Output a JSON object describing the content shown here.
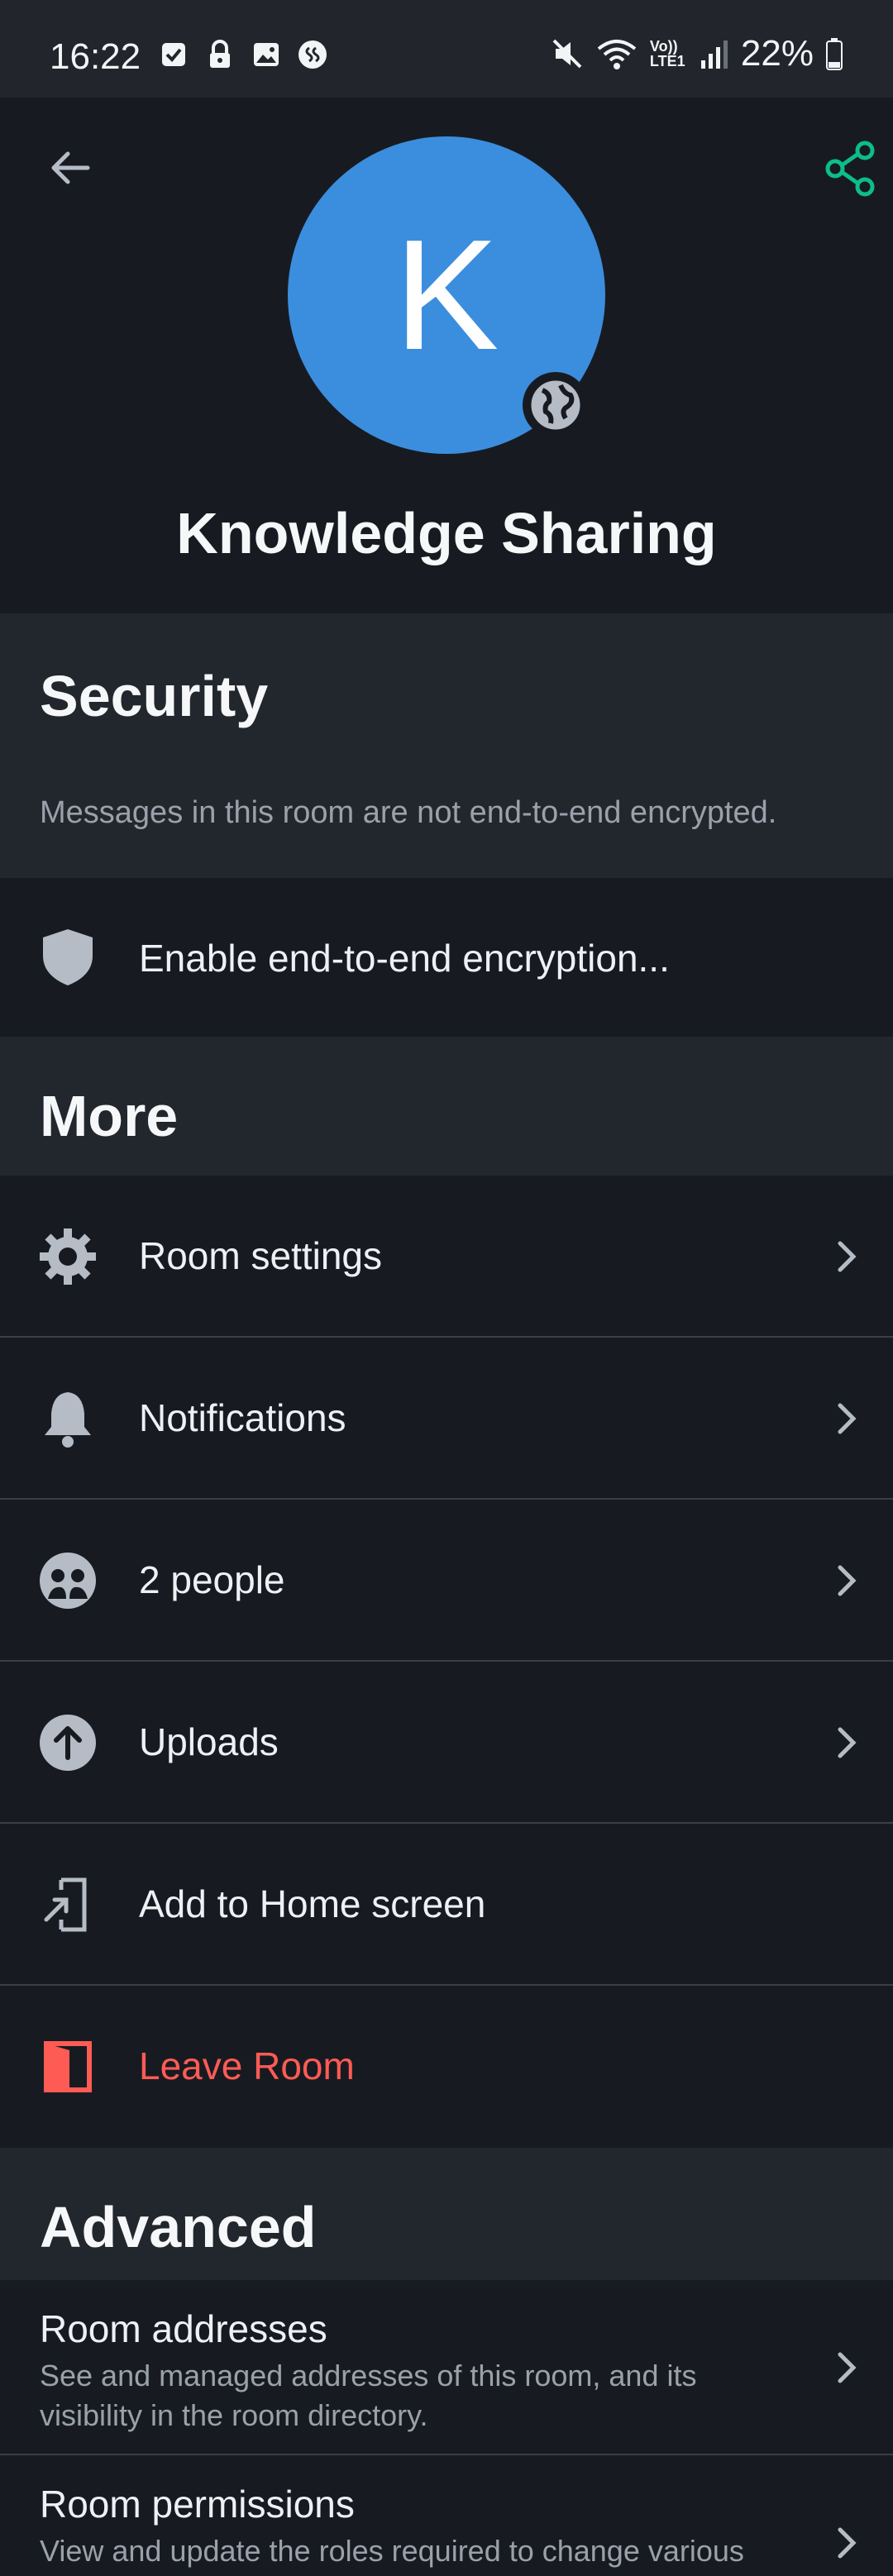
{
  "status_bar": {
    "time": "16:22",
    "battery": "22%",
    "network_label": "Vo)) LTE1"
  },
  "header": {
    "avatar_letter": "K",
    "room_name": "Knowledge Sharing"
  },
  "security": {
    "title": "Security",
    "description": "Messages in this room are not end-to-end encrypted.",
    "enable_label": "Enable end-to-end encryption..."
  },
  "more": {
    "title": "More",
    "items": [
      {
        "label": "Room settings"
      },
      {
        "label": "Notifications"
      },
      {
        "label": "2 people"
      },
      {
        "label": "Uploads"
      },
      {
        "label": "Add to Home screen"
      },
      {
        "label": "Leave Room"
      }
    ]
  },
  "advanced": {
    "title": "Advanced",
    "items": [
      {
        "title": "Room addresses",
        "subtitle": "See and managed addresses of this room, and its visibility in the room directory."
      },
      {
        "title": "Room permissions",
        "subtitle": "View and update the roles required to change various"
      }
    ]
  },
  "colors": {
    "accent_green": "#0dbd8b",
    "avatar_blue": "#3b8ede",
    "danger_red": "#ff5b55",
    "icon_gray": "#b5bcc6"
  }
}
